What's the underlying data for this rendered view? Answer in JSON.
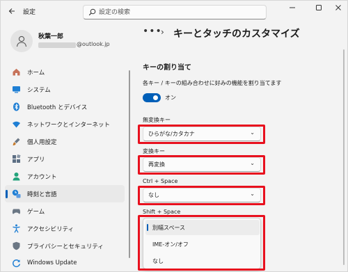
{
  "window": {
    "title": "設定",
    "controls": [
      "minimize",
      "maximize",
      "close"
    ]
  },
  "search": {
    "placeholder": "設定の検索",
    "icon": "search-icon"
  },
  "profile": {
    "name": "秋葉一郎",
    "email": "@outlook.jp"
  },
  "sidebar": {
    "items": [
      {
        "label": "ホーム",
        "icon": "home-icon",
        "color": "#c7735a"
      },
      {
        "label": "システム",
        "icon": "system-icon",
        "color": "#1f7fd4"
      },
      {
        "label": "Bluetooth とデバイス",
        "icon": "bluetooth-icon",
        "color": "#1f7fd4"
      },
      {
        "label": "ネットワークとインターネット",
        "icon": "network-icon",
        "color": "#1f7fd4"
      },
      {
        "label": "個人用設定",
        "icon": "brush-icon",
        "color": "#c57a2c"
      },
      {
        "label": "アプリ",
        "icon": "apps-icon",
        "color": "#5d6f84"
      },
      {
        "label": "アカウント",
        "icon": "account-icon",
        "color": "#23a37b"
      },
      {
        "label": "時刻と言語",
        "icon": "time-language-icon",
        "color": "#1f7fd4"
      },
      {
        "label": "ゲーム",
        "icon": "gaming-icon",
        "color": "#6b7784"
      },
      {
        "label": "アクセシビリティ",
        "icon": "accessibility-icon",
        "color": "#1f7fd4"
      },
      {
        "label": "プライバシーとセキュリティ",
        "icon": "shield-icon",
        "color": "#6b7784"
      },
      {
        "label": "Windows Update",
        "icon": "update-icon",
        "color": "#1f7fd4"
      }
    ],
    "selected": "時刻と言語"
  },
  "breadcrumb": {
    "more": "•••",
    "separator": "›",
    "title": "キーとタッチのカスタマイズ"
  },
  "section": {
    "title": "キーの割り当て",
    "description": "各キー / キーの組み合わせに好みの機能を割り当てます",
    "toggle_label": "オン",
    "toggle_on": true
  },
  "fields": [
    {
      "label": "無変換キー",
      "value": "ひらがな/カタカナ"
    },
    {
      "label": "変換キー",
      "value": "再変換"
    },
    {
      "label": "Ctrl + Space",
      "value": "なし"
    },
    {
      "label": "Shift + Space",
      "value": ""
    }
  ],
  "menu": {
    "options": [
      "別幅スペース",
      "IME-オン/オフ",
      "なし"
    ],
    "selected": "別幅スペース"
  },
  "accent_color": "#005fb8",
  "highlight_color": "#e8101e"
}
